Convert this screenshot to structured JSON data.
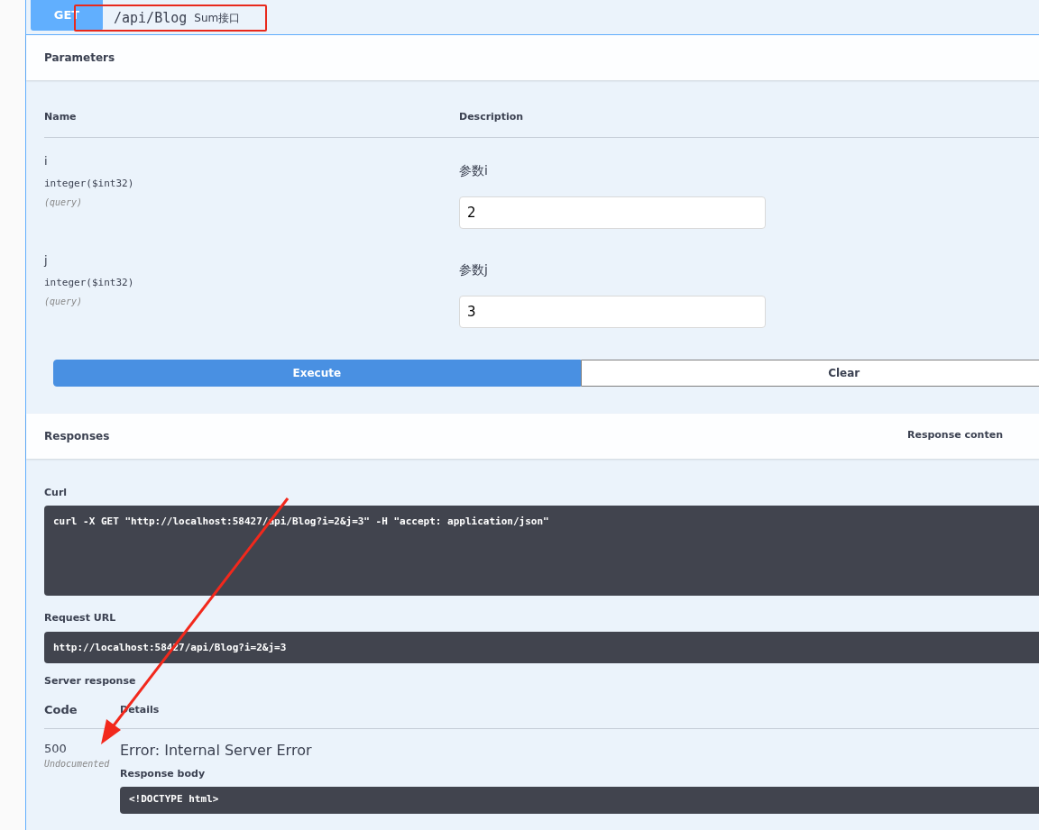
{
  "operation": {
    "method": "GET",
    "path": "/api/Blog",
    "summary": "Sum接口"
  },
  "parameters": {
    "title": "Parameters",
    "columns": [
      "Name",
      "Description"
    ],
    "rows": [
      {
        "name": "i",
        "type": "integer($int32)",
        "location": "(query)",
        "description": "参数i",
        "value": "2"
      },
      {
        "name": "j",
        "type": "integer($int32)",
        "location": "(query)",
        "description": "参数j",
        "value": "3"
      }
    ]
  },
  "buttons": {
    "execute": "Execute",
    "clear": "Clear"
  },
  "responses": {
    "title": "Responses",
    "content_type_label": "Response conten",
    "curl_label": "Curl",
    "curl": "curl -X GET \"http://localhost:58427/api/Blog?i=2&j=3\" -H \"accept: application/json\"",
    "request_url_label": "Request URL",
    "request_url": "http://localhost:58427/api/Blog?i=2&j=3",
    "server_response_label": "Server response",
    "columns": [
      "Code",
      "Details"
    ],
    "rows": [
      {
        "code": "500",
        "code_note": "Undocumented",
        "details": "Error: Internal Server Error",
        "body_label": "Response body",
        "body": "<!DOCTYPE html>"
      }
    ]
  }
}
